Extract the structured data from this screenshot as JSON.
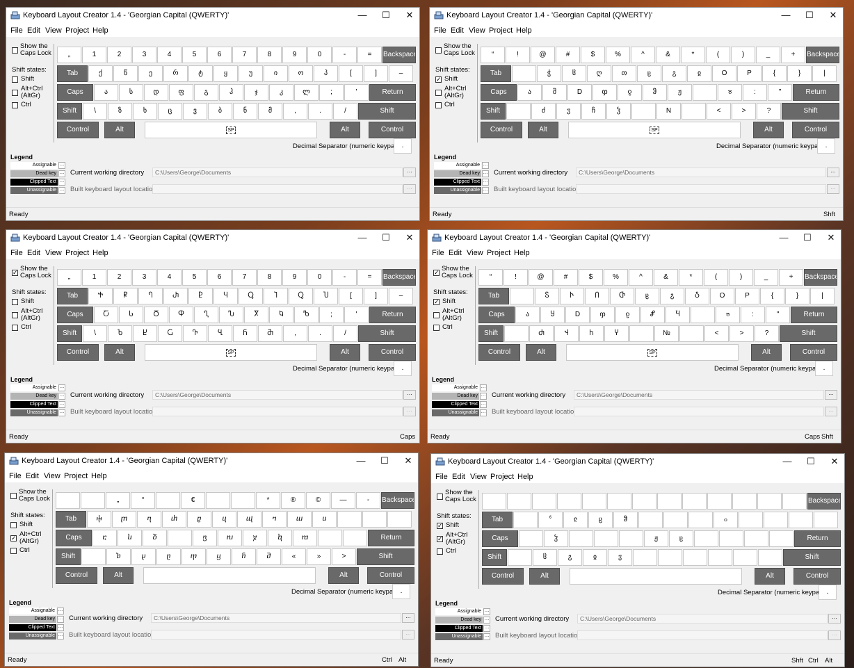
{
  "app_title": "Keyboard Layout Creator 1.4 - 'Georgian Capital (QWERTY)'",
  "menu": [
    "File",
    "Edit",
    "View",
    "Project",
    "Help"
  ],
  "labels": {
    "show_caps": "Show the",
    "show_caps2": "Caps Lock",
    "shift_states": "Shift states:",
    "shift": "Shift",
    "altctrl": "Alt+Ctrl",
    "altgr": "(AltGr)",
    "ctrl": "Ctrl",
    "legend": "Legend",
    "decimal": "Decimal Separator (numeric keypad)",
    "cwd": "Current working directory",
    "built": "Built keyboard layout location",
    "cwd_value": "C:\\Users\\George\\Documents",
    "ready": "Ready",
    "decimal_key": "."
  },
  "legend_items": [
    {
      "label": "Assignable",
      "bg": "#ffffff",
      "fg": "#000000"
    },
    {
      "label": "Dead key",
      "bg": "#b4b4b4",
      "fg": "#000000"
    },
    {
      "label": "Clipped Text",
      "bg": "#000000",
      "fg": "#ffffff"
    },
    {
      "label": "Unassignable",
      "bg": "#696969",
      "fg": "#ffffff"
    }
  ],
  "fixed_keys": {
    "backspace": "Backspace",
    "tab": "Tab",
    "caps": "Caps",
    "return": "Return",
    "shift": "Shift",
    "control": "Control",
    "alt": "Alt"
  },
  "panels": [
    {
      "caps": false,
      "shift": false,
      "altgr": false,
      "ctrl": false,
      "status": [],
      "row1": [
        "„",
        "1",
        "2",
        "3",
        "4",
        "5",
        "6",
        "7",
        "8",
        "9",
        "0",
        "-",
        "="
      ],
      "row2": [
        "ქ",
        "წ",
        "ე",
        "რ",
        "ტ",
        "ყ",
        "უ",
        "ი",
        "ო",
        "პ",
        "[",
        "]",
        "–"
      ],
      "row3": [
        "ა",
        "ს",
        "დ",
        "ფ",
        "გ",
        "ჰ",
        "ჯ",
        "კ",
        "ლ",
        ";",
        "'"
      ],
      "row4": [
        "\\",
        "ზ",
        "ხ",
        "ც",
        "ვ",
        "ბ",
        "ნ",
        "მ",
        ",",
        ".",
        "/"
      ],
      "spacebar": "SP"
    },
    {
      "caps": false,
      "shift": true,
      "altgr": false,
      "ctrl": false,
      "status": [
        "Shft"
      ],
      "row1": [
        "“",
        "!",
        "@",
        "#",
        "$",
        "%",
        "^",
        "&",
        "*",
        "(",
        ")",
        "_",
        "+"
      ],
      "row2": [
        "",
        "ჭ",
        "ჱ",
        "ღ",
        "თ",
        "ჸ",
        "ჷ",
        "ჲ",
        "O",
        "P",
        "{",
        "}",
        "|"
      ],
      "row3": [
        "ა",
        "შ",
        "D",
        "ჶ",
        "ჹ",
        "ჵ",
        "ჟ",
        "",
        "ჾ",
        ":",
        "\""
      ],
      "row4": [
        "",
        "ძ",
        "ჳ",
        "ჩ",
        "ჴ",
        "",
        "N",
        "",
        "<",
        ">",
        "?"
      ],
      "spacebar": "SP"
    },
    {
      "caps": true,
      "shift": false,
      "altgr": false,
      "ctrl": false,
      "status": [
        "Caps"
      ],
      "row1": [
        "„",
        "1",
        "2",
        "3",
        "4",
        "5",
        "6",
        "7",
        "8",
        "9",
        "0",
        "-",
        "="
      ],
      "row2": [
        "Ⴕ",
        "Ⴜ",
        "Ⴄ",
        "Ⴐ",
        "Ⴒ",
        "Ⴗ",
        "Ⴓ",
        "Ⴈ",
        "Ⴍ",
        "Ⴎ",
        "[",
        "]",
        "–"
      ],
      "row3": [
        "Ⴀ",
        "Ⴑ",
        "Ⴃ",
        "Ⴔ",
        "Ⴂ",
        "Ⴠ",
        "Ⴟ",
        "Ⴉ",
        "Ⴊ",
        ";",
        "'"
      ],
      "row4": [
        "\\",
        "Ⴆ",
        "Ⴞ",
        "Ⴚ",
        "Ⴅ",
        "Ⴁ",
        "Ⴌ",
        "Ⴋ",
        ",",
        ".",
        "/"
      ],
      "spacebar": "SP"
    },
    {
      "caps": true,
      "shift": true,
      "altgr": false,
      "ctrl": false,
      "status": [
        "Caps",
        "Shft"
      ],
      "row1": [
        "“",
        "!",
        "@",
        "#",
        "$",
        "%",
        "^",
        "&",
        "*",
        "(",
        ")",
        "_",
        "+"
      ],
      "row2": [
        "",
        "Ⴝ",
        "Ⴡ",
        "Ⴖ",
        "Ⴇ",
        "ჸ",
        "ჷ",
        "Ⴢ",
        "O",
        "P",
        "{",
        "}",
        "|"
      ],
      "row3": [
        "ა",
        "Ⴘ",
        "D",
        "ჶ",
        "ჹ",
        "Ⴥ",
        "Ⴏ",
        "",
        "ჾ",
        ":",
        "\""
      ],
      "row4": [
        "",
        "Ⴛ",
        "Ⴣ",
        "Ⴙ",
        "Ⴤ",
        "",
        "№",
        "",
        "<",
        ">",
        "?"
      ],
      "spacebar": "SP"
    },
    {
      "caps": false,
      "shift": false,
      "altgr": true,
      "ctrl": false,
      "status": [
        "Ctrl",
        "Alt"
      ],
      "row1": [
        "",
        "",
        "„",
        "“",
        "",
        "€",
        "",
        "",
        "*",
        "®",
        "©",
        "—",
        "-"
      ],
      "row2": [
        "ⴕ",
        "ⴜ",
        "ⴄ",
        "ⴐ",
        "ⴒ",
        "ⴗ",
        "ⴓ",
        "ⴈ",
        "ⴍ",
        "ⴎ",
        "",
        "",
        ""
      ],
      "row3": [
        "ⴀ",
        "ⴑ",
        "ⴃ",
        "",
        "ⴂ",
        "ⴠ",
        "ⴟ",
        "ⴉ",
        "ⴊ",
        "",
        ""
      ],
      "row4": [
        "",
        "ⴆ",
        "ⴞ",
        "ⴚ",
        "ⴅ",
        "ⴁ",
        "ⴌ",
        "ⴋ",
        "«",
        "»",
        ">"
      ],
      "spacebar": ""
    },
    {
      "caps": false,
      "shift": true,
      "altgr": true,
      "ctrl": false,
      "status": [
        "Shft",
        "Ctrl",
        "Alt"
      ],
      "row1": [
        "",
        "",
        "",
        "",
        "",
        "",
        "",
        "",
        "",
        "",
        "",
        "",
        ""
      ],
      "row2": [
        "",
        "ჼ",
        "ჺ",
        "ჸ",
        "ჵ",
        "",
        "",
        "",
        "ჿ",
        "",
        "",
        "",
        ""
      ],
      "row3": [
        "",
        "ჴ",
        "",
        "",
        "",
        "ჟ",
        "ჸ",
        "",
        "",
        "",
        ""
      ],
      "row4": [
        "",
        "ჱ",
        "ჷ",
        "ჲ",
        "ჳ",
        "",
        "",
        "",
        "",
        "",
        ""
      ],
      "spacebar": ""
    }
  ]
}
